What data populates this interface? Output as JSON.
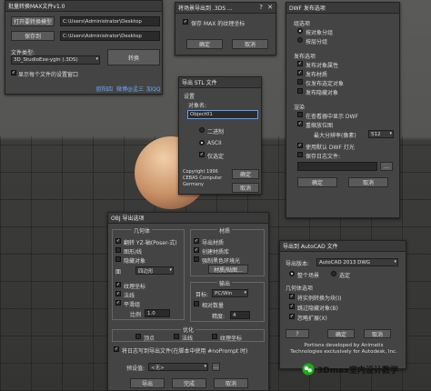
{
  "batch": {
    "title": "批量转换MAX文件v1.0",
    "open_btn": "打开要转换模型",
    "save_btn": "保存到",
    "path1": "C:\\Users\\Administrator\\Desktop",
    "path2": "C:\\Users\\Administrator\\Desktop",
    "type_label": "文件类型:",
    "type_value": "3D_StudioExe-ygin (.3DS)",
    "convert_btn": "转换",
    "show_label": "显示每个文件的设置窗口",
    "footer_a": "欧阳四",
    "footer_b": "微博@孟三",
    "footer_c": "加QQ"
  },
  "scene3ds": {
    "title": "将场景导出到 .3DS ...",
    "check": "保存 MAX 的纹理坐标",
    "ok": "确定",
    "cancel": "取消"
  },
  "dwf": {
    "title": "DWF 发布选项",
    "group_label": "组选项",
    "opt1": "按对象分组",
    "opt2": "按层分组",
    "pub_label": "发布选项",
    "pub1": "发布对象属性",
    "pub2": "发布材质",
    "pub3": "仅发布选定对象",
    "pub4": "发布隐藏对象",
    "bg_label": "渲染",
    "bg1": "在查看器中显示 DWF",
    "bg2": "重缩放位图",
    "bg3_label": "最大分辨率(像素)",
    "bg3_value": "512",
    "bg4": "使用默认 DWF 灯光",
    "bg5": "保存日志文件:",
    "ok": "确定",
    "cancel": "取消"
  },
  "stl": {
    "title": "导出 STL 文件",
    "settings": "设置",
    "obj_label": "对象名:",
    "obj_value": "Object01",
    "binary": "二进制",
    "ascii": "ASCII",
    "selected": "仅选定",
    "copyright": "Copyright 1996 CEBAS Computer Germany",
    "ok": "确定",
    "cancel": "取消"
  },
  "obj": {
    "title": "OBJ 导出选项",
    "geom_label": "几何体",
    "flip": "翻转 YZ-轴(Poser-式)",
    "shapes": "图形/线",
    "hidden": "隐藏对象",
    "faces_label": "面",
    "faces_value": "四边形",
    "tex": "纹理坐标",
    "normals": "法线",
    "smooth": "平滑组",
    "scale_label": "比例",
    "scale_value": "1.0",
    "mat_label": "材质",
    "export_mat": "导出材质",
    "create_lib": "创建材质库",
    "use_map": "强制黑色环境光",
    "map_path": "材质/贴图...",
    "output_label": "输出",
    "target_label": "目标:",
    "target_value": "PC/Win",
    "relative": "相对数量",
    "precision_label": "精度:",
    "precision_value": "4",
    "optimize_label": "优化",
    "vertex": "顶点",
    "normal2": "法线",
    "texcoord": "纹理坐标",
    "write_path": "将日志写到导出文件(在脚本中使用 #noPrompt 时)",
    "preset_label": "预设值:",
    "preset_value": "<无>",
    "export_btn": "导出",
    "done_btn": "完成",
    "cancel_btn": "取消"
  },
  "acad": {
    "title": "导出到 AutoCAD 文件",
    "ver_label": "导出版本:",
    "ver_value": "AutoCAD 2013 DWG",
    "opt_whole": "整个场景",
    "opt_sel": "选定",
    "geom_label": "几何体选项",
    "g1": "将实例转换为块(I)",
    "g2": "跳过隐藏对象(B)",
    "g3": "忽略扩展(X)",
    "ok": "确定",
    "cancel": "取消",
    "note": "Portions developed by Animatix Technologies exclusively for Autodesk, Inc."
  },
  "watermark": {
    "text": "3Dmax室内设计教学"
  }
}
